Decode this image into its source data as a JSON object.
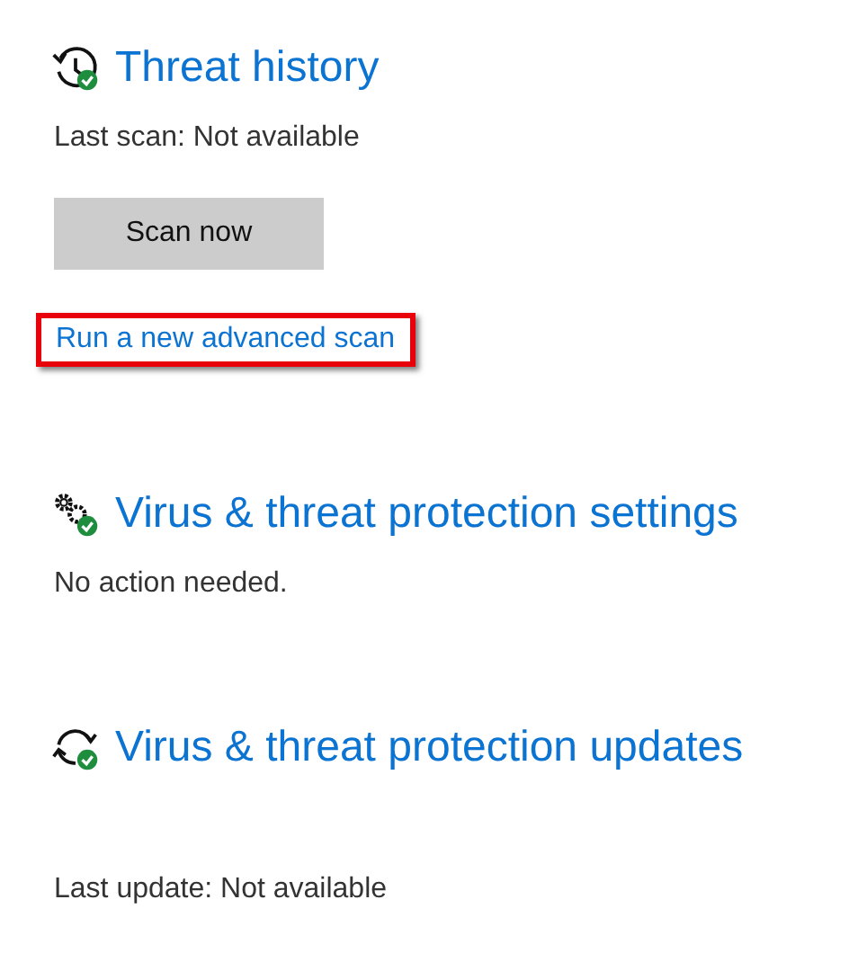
{
  "sections": [
    {
      "kind": "history",
      "title": "Threat history",
      "status": "Last scan:  Not available",
      "button": "Scan now",
      "link": {
        "label": "Run a new advanced scan",
        "highlighted": true
      }
    },
    {
      "kind": "settings",
      "title": "Virus & threat protection settings",
      "status": "No action needed."
    },
    {
      "kind": "update",
      "title": "Virus & threat protection updates",
      "status": "Last update: Not available"
    }
  ]
}
